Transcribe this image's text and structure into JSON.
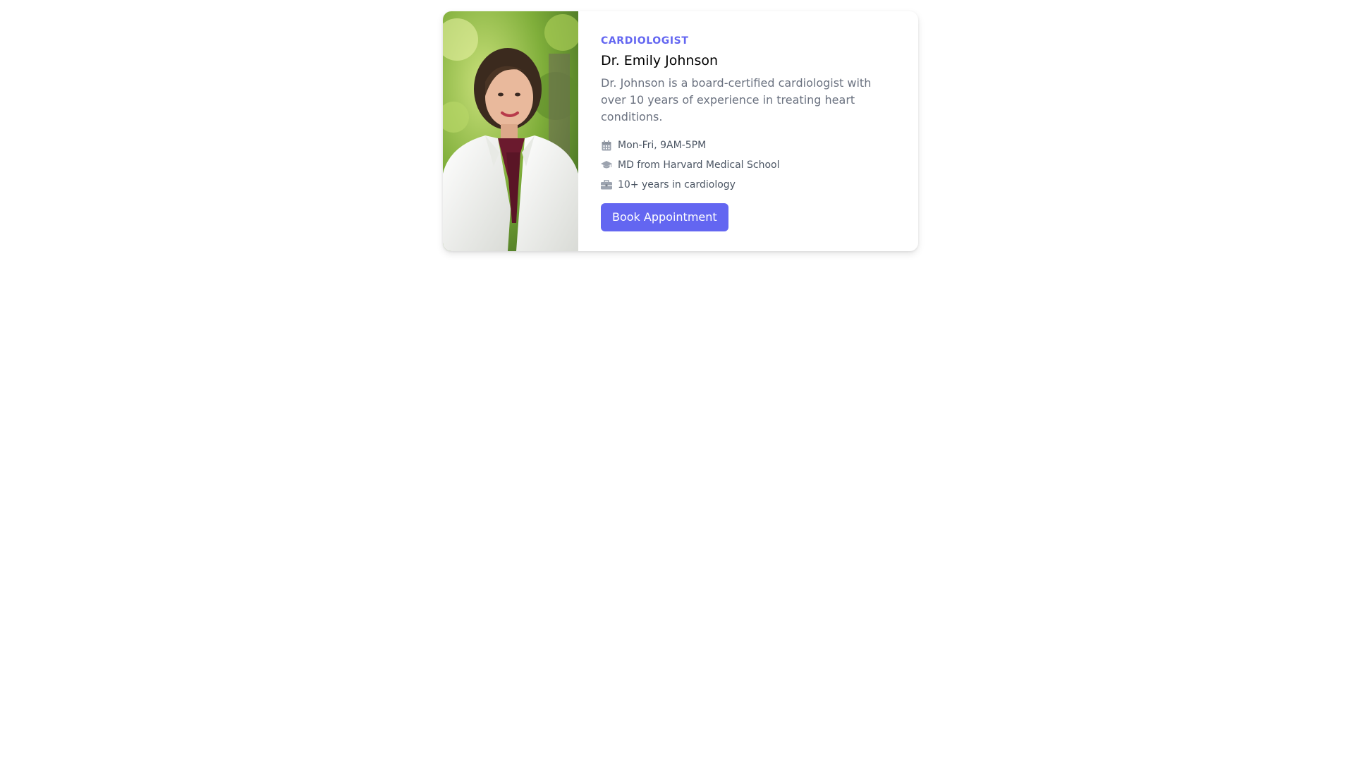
{
  "doctor": {
    "specialty": "CARDIOLOGIST",
    "name": "Dr. Emily Johnson",
    "description": "Dr. Johnson is a board-certified cardiologist with over 10 years of experience in treating heart conditions.",
    "photo_alt": "Dr. Emily Johnson"
  },
  "info": [
    {
      "icon": "calendar-icon",
      "text": "Mon-Fri, 9AM-5PM"
    },
    {
      "icon": "graduation-cap-icon",
      "text": "MD from Harvard Medical School"
    },
    {
      "icon": "briefcase-icon",
      "text": "10+ years in cardiology"
    }
  ],
  "actions": {
    "book_label": "Book Appointment"
  },
  "colors": {
    "accent": "#6366f1",
    "muted_text": "#6b7280",
    "icon": "#9ca3af"
  }
}
